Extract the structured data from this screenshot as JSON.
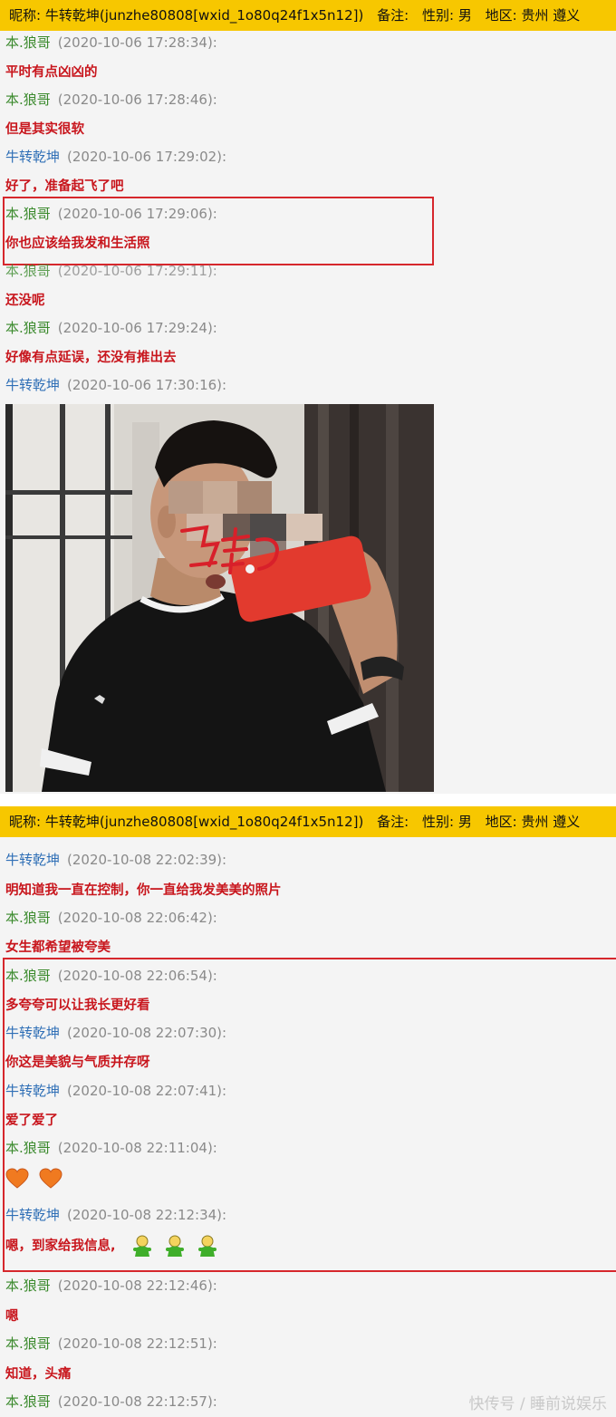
{
  "section1": {
    "header": {
      "nickname_label": "昵称:",
      "nickname": "牛转乾坤(junzhe80808[wxid_1o80q24f1x5n12])",
      "remark_label": "备注:",
      "gender_label": "性别:",
      "gender": "男",
      "region_label": "地区:",
      "region": "贵州 遵义"
    },
    "messages": [
      {
        "sender": "本.狼哥",
        "time": "(2020-10-06 17:28:34):",
        "text": "平时有点凶凶的"
      },
      {
        "sender": "本.狼哥",
        "time": "(2020-10-06 17:28:46):",
        "text": "但是其实很软"
      },
      {
        "sender": "牛转乾坤",
        "time": "(2020-10-06 17:29:02):",
        "text": "好了，准备起飞了吧"
      },
      {
        "sender": "本.狼哥",
        "time": "(2020-10-06 17:29:06):",
        "text": "你也应该给我发和生活照"
      },
      {
        "sender": "本.狼哥",
        "time": "(2020-10-06 17:29:11):",
        "text": "还没呢"
      },
      {
        "sender": "本.狼哥",
        "time": "(2020-10-06 17:29:24):",
        "text": "好像有点延误，还没有推出去"
      },
      {
        "sender": "牛转乾坤",
        "time": "(2020-10-06 17:30:16):",
        "text": ""
      }
    ],
    "photo_annotation": "马赛克"
  },
  "section2": {
    "header": {
      "nickname_label": "昵称:",
      "nickname": "牛转乾坤(junzhe80808[wxid_1o80q24f1x5n12])",
      "remark_label": "备注:",
      "gender_label": "性别:",
      "gender": "男",
      "region_label": "地区:",
      "region": "贵州 遵义"
    },
    "messages": [
      {
        "sender": "牛转乾坤",
        "time": "(2020-10-08 22:02:39):",
        "text": "明知道我一直在控制，你一直给我发美美的照片"
      },
      {
        "sender": "本.狼哥",
        "time": "(2020-10-08 22:06:42):",
        "text": "女生都希望被夸美"
      },
      {
        "sender": "本.狼哥",
        "time": "(2020-10-08 22:06:54):",
        "text": "多夸夸可以让我长更好看"
      },
      {
        "sender": "牛转乾坤",
        "time": "(2020-10-08 22:07:30):",
        "text": "你这是美貌与气质并存呀"
      },
      {
        "sender": "牛转乾坤",
        "time": "(2020-10-08 22:07:41):",
        "text": "爱了爱了"
      },
      {
        "sender": "本.狼哥",
        "time": "(2020-10-08 22:11:04):",
        "text": ""
      },
      {
        "sender": "牛转乾坤",
        "time": "(2020-10-08 22:12:34):",
        "text": "嗯，到家给我信息,"
      },
      {
        "sender": "本.狼哥",
        "time": "(2020-10-08 22:12:46):",
        "text": "嗯"
      },
      {
        "sender": "本.狼哥",
        "time": "(2020-10-08 22:12:51):",
        "text": "知道，头痛"
      },
      {
        "sender": "本.狼哥",
        "time": "(2020-10-08 22:12:57):",
        "text": ""
      }
    ]
  },
  "watermark": "快传号 / 睡前说娱乐",
  "colors": {
    "header_bg": "#f7c700",
    "message_red": "#c8161d",
    "sender_green": "#3b8a2d",
    "sender_blue": "#2f6fb6",
    "highlight_box": "#d6272c"
  },
  "icons": [
    "heart-emoji-icon",
    "green-figure-emoji-icon"
  ]
}
